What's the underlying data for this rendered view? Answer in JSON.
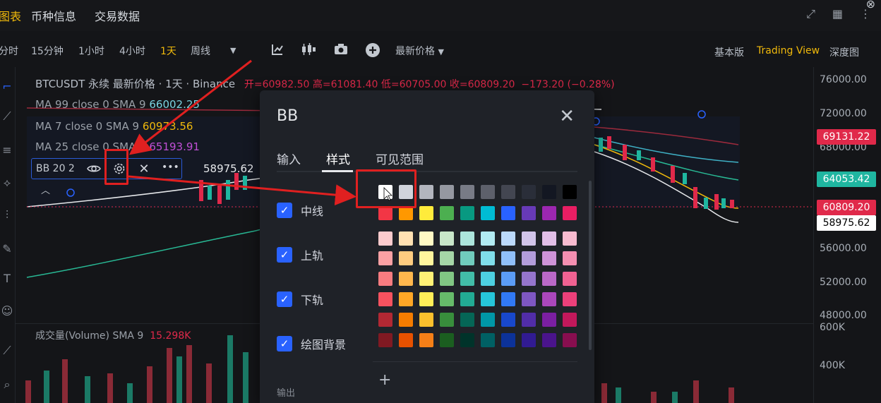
{
  "topbar": {
    "tabs": [
      {
        "label": "图表",
        "active": true
      },
      {
        "label": "币种信息",
        "active": false
      },
      {
        "label": "交易数据",
        "active": false
      }
    ]
  },
  "toolbar": {
    "timeframes": [
      {
        "label": "分时",
        "active": false
      },
      {
        "label": "15分钟",
        "active": false
      },
      {
        "label": "1小时",
        "active": false
      },
      {
        "label": "4小时",
        "active": false
      },
      {
        "label": "1天",
        "active": true
      },
      {
        "label": "周线",
        "active": false
      }
    ],
    "more_icon": "chevron-down-icon",
    "price_type": "最新价格",
    "views": [
      {
        "label": "基本版",
        "active": false
      },
      {
        "label": "Trading View",
        "active": true
      },
      {
        "label": "深度图",
        "active": false
      }
    ]
  },
  "chart": {
    "title": "BTCUSDT 永续 最新价格 · 1天 · Binance",
    "ohlc": {
      "open_label": "开=",
      "open": "60982.50",
      "high_label": "高=",
      "high": "61081.40",
      "low_label": "低=",
      "low": "60705.00",
      "close_label": "收=",
      "close": "60809.20",
      "change": "−173.20 (−0.28%)"
    },
    "indicators": [
      {
        "label": "MA 99 close 0 SMA 9",
        "value": "66002.25",
        "color": "#7ad3e0"
      },
      {
        "label": "MA 7 close 0 SMA 9",
        "value": "60973.56",
        "color": "#f0b90b"
      },
      {
        "label": "MA 25 close 0 SMA 9",
        "value": "65193.91",
        "color": "#c04fd6"
      }
    ],
    "bb": {
      "label": "BB 20 2",
      "value": "58975.62",
      "collapse_icon": "chevron-up-icon"
    },
    "volume": {
      "label": "成交量(Volume) SMA 9",
      "value": "15.298K"
    }
  },
  "yaxis": {
    "ticks": [
      "76000.00",
      "72000.00",
      "68000.00",
      "56000.00",
      "52000.00",
      "48000.00"
    ],
    "volume_ticks": [
      "600K",
      "400K"
    ],
    "tags": [
      {
        "value": "69131.22",
        "bg": "#e0294a"
      },
      {
        "value": "64053.42",
        "bg": "#1fb6a0"
      },
      {
        "value": "60809.20",
        "bg": "#e0294a"
      },
      {
        "value": "58975.62",
        "bg": "#ffffff"
      }
    ]
  },
  "modal": {
    "title": "BB",
    "tabs": [
      {
        "label": "输入",
        "active": false
      },
      {
        "label": "样式",
        "active": true
      },
      {
        "label": "可见范围",
        "active": false
      }
    ],
    "checkboxes": [
      {
        "label": "中线",
        "checked": true
      },
      {
        "label": "上轨",
        "checked": true
      },
      {
        "label": "下轨",
        "checked": true
      },
      {
        "label": "绘图背景",
        "checked": true
      }
    ],
    "output_label": "输出",
    "add_label": "+"
  },
  "palette": {
    "rows": [
      [
        "#ffffff",
        "#d1d4dc",
        "#b2b5be",
        "#9598a1",
        "#787b86",
        "#5d606b",
        "#434651",
        "#2a2e39",
        "#131722",
        "#000000"
      ],
      [
        "#f23645",
        "#ff9800",
        "#ffeb3b",
        "#4caf50",
        "#089981",
        "#00bcd4",
        "#2962ff",
        "#673ab7",
        "#9c27b0",
        "#e91e63"
      ],
      [
        "#fccbcd",
        "#ffe0b2",
        "#fff9c4",
        "#c8e6c9",
        "#ace5dc",
        "#b2ebf2",
        "#bbd9fb",
        "#d1c4e9",
        "#e1bee7",
        "#f8bbd0"
      ],
      [
        "#faa1a4",
        "#ffcc80",
        "#fff59d",
        "#a5d6a7",
        "#70ccbd",
        "#80deea",
        "#90bff9",
        "#b39ddb",
        "#ce93d8",
        "#f48fb1"
      ],
      [
        "#f77c80",
        "#ffb74d",
        "#fff176",
        "#81c784",
        "#42bda8",
        "#4dd0e1",
        "#5b9cf6",
        "#9575cd",
        "#ba68c8",
        "#f06292"
      ],
      [
        "#f7525f",
        "#ffa726",
        "#ffee58",
        "#66bb6a",
        "#22ab94",
        "#26c6da",
        "#3179f5",
        "#7e57c2",
        "#ab47bc",
        "#ec407a"
      ],
      [
        "#b22833",
        "#f57c00",
        "#fbc02d",
        "#388e3c",
        "#056656",
        "#0097a7",
        "#1848cc",
        "#512da8",
        "#7b1fa2",
        "#c2185b"
      ],
      [
        "#801922",
        "#e65100",
        "#f57f17",
        "#1b5e20",
        "#00332a",
        "#006064",
        "#0c3299",
        "#311b92",
        "#4a148c",
        "#880e4f"
      ]
    ],
    "selected": "#ffffff"
  }
}
